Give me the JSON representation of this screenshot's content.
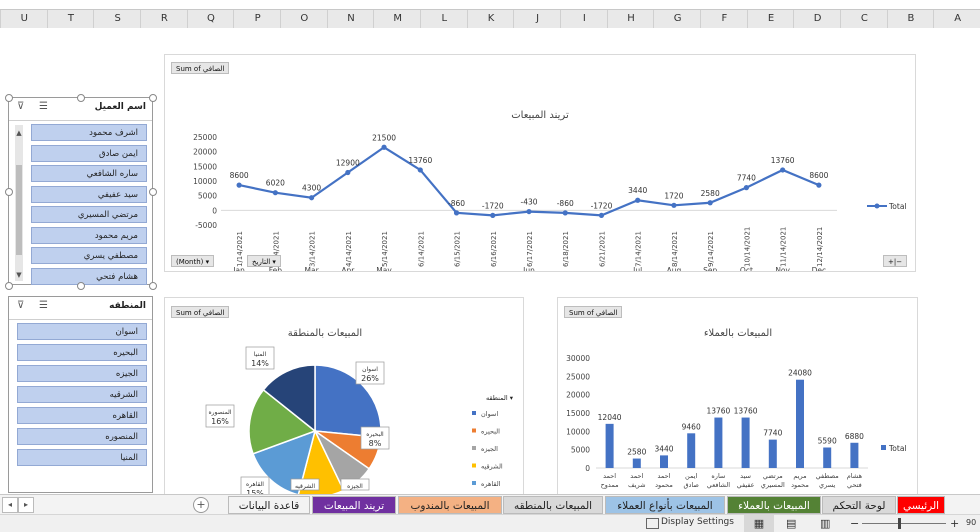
{
  "columns": [
    "U",
    "T",
    "S",
    "R",
    "Q",
    "P",
    "O",
    "N",
    "M",
    "L",
    "K",
    "J",
    "I",
    "H",
    "G",
    "F",
    "E",
    "D",
    "C",
    "B",
    "A"
  ],
  "line_chart": {
    "field_button": "Sum of الصافي",
    "title": "تريند المبيعات",
    "legend": "Total",
    "filter_month": "(Month) ▾",
    "filter_date": "التاريخ ▾",
    "expand": "+|−",
    "chart_data": {
      "type": "line",
      "x": [
        "1/14/2021",
        "2/14/2021",
        "3/14/2021",
        "4/14/2021",
        "5/14/2021",
        "6/14/2021",
        "6/15/2021",
        "6/16/2021",
        "6/17/2021",
        "6/18/2021",
        "6/21/2021",
        "7/14/2021",
        "8/14/2021",
        "9/14/2021",
        "10/14/2021",
        "11/14/2021",
        "12/14/2021"
      ],
      "values": [
        8600,
        6020,
        4300,
        12900,
        21500,
        13760,
        -860,
        -1720,
        -430,
        -860,
        -1720,
        3440,
        1720,
        2580,
        7740,
        13760,
        8600
      ],
      "month_labels": [
        "Jan",
        "Feb",
        "Mar",
        "Apr",
        "May",
        "",
        "",
        "",
        "Jun",
        "",
        "",
        "Jul",
        "Aug",
        "Sep",
        "Oct",
        "Nov",
        "Dec"
      ],
      "yticks": [
        "25000",
        "20000",
        "15000",
        "10000",
        "5000",
        "0",
        "-5000"
      ],
      "ylim": [
        -5000,
        25000
      ],
      "series": [
        {
          "name": "Total",
          "color": "#4472c4"
        }
      ]
    }
  },
  "pie_chart": {
    "field_button": "Sum of الصافي",
    "title": "المبيعات بالمنطقة",
    "legend_header": "المنطقه ▾",
    "chart_data": {
      "type": "pie",
      "categories": [
        "اسوان",
        "البحيره",
        "الجيزه",
        "الشرقيه",
        "القاهره",
        "المنصوره",
        "المنيا"
      ],
      "values": [
        26,
        8,
        8,
        11,
        15,
        16,
        14
      ],
      "colors": [
        "#4472c4",
        "#ed7d31",
        "#a5a5a5",
        "#ffc000",
        "#5b9bd5",
        "#70ad47",
        "#264478"
      ],
      "data_labels": [
        {
          "name": "اسوان",
          "pct": "26%"
        },
        {
          "name": "البحيره",
          "pct": "8%"
        },
        {
          "name": "الجيزه",
          "pct": ""
        },
        {
          "name": "الشرقيه",
          "pct": ""
        },
        {
          "name": "القاهره",
          "pct": "15%"
        },
        {
          "name": "المنصوره",
          "pct": "16%"
        },
        {
          "name": "المنيا",
          "pct": "14%"
        }
      ]
    }
  },
  "bar_chart": {
    "field_button": "Sum of الصافي",
    "title": "المبيعات بالعملاء",
    "legend": "Total",
    "chart_data": {
      "type": "bar",
      "categories": [
        "احمد ممدوح",
        "احمد شريف",
        "احمد محمود",
        "ايمن صادق",
        "ساره الشافعي",
        "سيد عفيفي",
        "مرتضي المسيري",
        "مريم محمود",
        "مصطفي يسري",
        "هشام فتحي"
      ],
      "category_lines": [
        [
          "احمد",
          "ممدوح"
        ],
        [
          "احمد",
          "شريف"
        ],
        [
          "احمد",
          "محمود"
        ],
        [
          "ايمن",
          "صادق"
        ],
        [
          "ساره",
          "الشافعي"
        ],
        [
          "سيد",
          "عفيفي"
        ],
        [
          "مرتضي",
          "المسيري"
        ],
        [
          "مريم",
          "محمود"
        ],
        [
          "مصطفي",
          "يسري"
        ],
        [
          "هشام",
          "فتحي"
        ]
      ],
      "values": [
        12040,
        2580,
        3440,
        9460,
        13760,
        13760,
        7740,
        24080,
        5590,
        6880
      ],
      "yticks": [
        "30000",
        "25000",
        "20000",
        "15000",
        "10000",
        "5000",
        "0"
      ],
      "ylim": [
        0,
        30000
      ],
      "series": [
        {
          "name": "Total",
          "color": "#4472c4"
        }
      ]
    }
  },
  "slicer_customer": {
    "title": "اسم العميل",
    "items": [
      "اشرف محمود",
      "ايمن صادق",
      "ساره الشافعي",
      "سيد عفيفي",
      "مرتضي المسيري",
      "مريم محمود",
      "مصطفي يسري",
      "هشام فتحي"
    ]
  },
  "slicer_region": {
    "title": "المنطقه",
    "items": [
      "اسوان",
      "البحيره",
      "الجيزه",
      "الشرقيه",
      "القاهره",
      "المنصوره",
      "المنيا"
    ]
  },
  "tabs": [
    {
      "label": "الرئيسي",
      "bg": "#ff0000",
      "fg": "#ffffff"
    },
    {
      "label": "لوحة التحكم",
      "bg": "#d9d9d9",
      "fg": "#222222"
    },
    {
      "label": "المبيعات بالعملاء",
      "bg": "#548235",
      "fg": "#ffffff"
    },
    {
      "label": "المبيعات بأنواع العملاء",
      "bg": "#9dc3e6",
      "fg": "#222222"
    },
    {
      "label": "المبيعات بالمنطقه",
      "bg": "#d9d9d9",
      "fg": "#222222"
    },
    {
      "label": "المبيعات بالمندوب",
      "bg": "#f4b183",
      "fg": "#222222"
    },
    {
      "label": "تريند المبيعات",
      "bg": "#7030a0",
      "fg": "#ffffff"
    },
    {
      "label": "قاعدة البيانات",
      "bg": "#f3f3f3",
      "fg": "#222222"
    }
  ],
  "status": {
    "display_settings": "Display Settings",
    "zoom": "90"
  }
}
